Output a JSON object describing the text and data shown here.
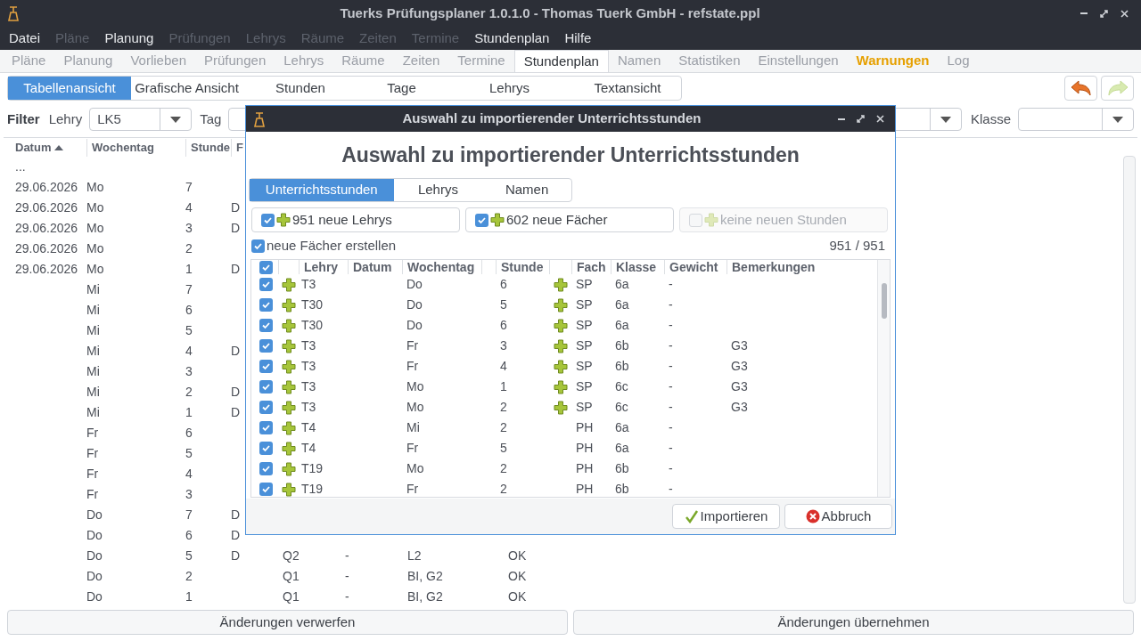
{
  "window": {
    "title": "Tuerks Prüfungsplaner 1.0.1.0 - Thomas Tuerk GmbH - refstate.ppl"
  },
  "menu": [
    {
      "label": "Datei",
      "disabled": false
    },
    {
      "label": "Pläne",
      "disabled": true
    },
    {
      "label": "Planung",
      "disabled": false
    },
    {
      "label": "Prüfungen",
      "disabled": true
    },
    {
      "label": "Lehrys",
      "disabled": true
    },
    {
      "label": "Räume",
      "disabled": true
    },
    {
      "label": "Zeiten",
      "disabled": true
    },
    {
      "label": "Termine",
      "disabled": true
    },
    {
      "label": "Stundenplan",
      "disabled": false
    },
    {
      "label": "Hilfe",
      "disabled": false
    }
  ],
  "tabs": [
    {
      "label": "Pläne",
      "selected": false,
      "kind": "normal"
    },
    {
      "label": "Planung",
      "selected": false,
      "kind": "normal"
    },
    {
      "label": "Vorlieben",
      "selected": false,
      "kind": "normal"
    },
    {
      "label": "Prüfungen",
      "selected": false,
      "kind": "normal"
    },
    {
      "label": "Lehrys",
      "selected": false,
      "kind": "normal"
    },
    {
      "label": "Räume",
      "selected": false,
      "kind": "normal"
    },
    {
      "label": "Zeiten",
      "selected": false,
      "kind": "normal"
    },
    {
      "label": "Termine",
      "selected": false,
      "kind": "normal"
    },
    {
      "label": "Stundenplan",
      "selected": true,
      "kind": "normal"
    },
    {
      "label": "Namen",
      "selected": false,
      "kind": "normal"
    },
    {
      "label": "Statistiken",
      "selected": false,
      "kind": "normal"
    },
    {
      "label": "Einstellungen",
      "selected": false,
      "kind": "normal"
    },
    {
      "label": "Warnungen",
      "selected": false,
      "kind": "warning"
    },
    {
      "label": "Log",
      "selected": false,
      "kind": "normal"
    }
  ],
  "subtabs": [
    {
      "label": "Tabellenansicht",
      "selected": true
    },
    {
      "label": "Grafische Ansicht",
      "selected": false
    },
    {
      "label": "Stunden",
      "selected": false
    },
    {
      "label": "Tage",
      "selected": false
    },
    {
      "label": "Lehrys",
      "selected": false
    },
    {
      "label": "Textansicht",
      "selected": false
    }
  ],
  "toolbar": {
    "undo_disabled": false,
    "redo_disabled": true
  },
  "filter": {
    "title": "Filter",
    "lehry_label": "Lehry",
    "lehry_value": "LK5",
    "tag_label": "Tag",
    "klasse_label": "Klasse"
  },
  "table": {
    "columns": [
      "Datum",
      "Wochentag",
      "Stunde",
      "F"
    ],
    "rows": [
      [
        "...",
        "",
        "",
        "",
        "",
        "",
        "",
        ""
      ],
      [
        "29.06.2026",
        "Mo",
        "7",
        "",
        "",
        "",
        "",
        ""
      ],
      [
        "29.06.2026",
        "Mo",
        "4",
        "D",
        "",
        "",
        "",
        ""
      ],
      [
        "29.06.2026",
        "Mo",
        "3",
        "D",
        "",
        "",
        "",
        ""
      ],
      [
        "29.06.2026",
        "Mo",
        "2",
        "",
        "",
        "",
        "",
        ""
      ],
      [
        "29.06.2026",
        "Mo",
        "1",
        "D",
        "",
        "",
        "",
        ""
      ],
      [
        "",
        "Mi",
        "7",
        "",
        "",
        "",
        "",
        ""
      ],
      [
        "",
        "Mi",
        "6",
        "",
        "",
        "",
        "",
        ""
      ],
      [
        "",
        "Mi",
        "5",
        "",
        "",
        "",
        "",
        ""
      ],
      [
        "",
        "Mi",
        "4",
        "D",
        "",
        "",
        "",
        ""
      ],
      [
        "",
        "Mi",
        "3",
        "",
        "",
        "",
        "",
        ""
      ],
      [
        "",
        "Mi",
        "2",
        "D",
        "",
        "",
        "",
        ""
      ],
      [
        "",
        "Mi",
        "1",
        "D",
        "",
        "",
        "",
        ""
      ],
      [
        "",
        "Fr",
        "6",
        "",
        "",
        "",
        "",
        ""
      ],
      [
        "",
        "Fr",
        "5",
        "",
        "",
        "",
        "",
        ""
      ],
      [
        "",
        "Fr",
        "4",
        "",
        "",
        "",
        "",
        ""
      ],
      [
        "",
        "Fr",
        "3",
        "",
        "",
        "",
        "",
        ""
      ],
      [
        "",
        "Do",
        "7",
        "D",
        "",
        "",
        "",
        ""
      ],
      [
        "",
        "Do",
        "6",
        "D",
        "",
        "",
        "",
        ""
      ],
      [
        "",
        "Do",
        "5",
        "D",
        "Q2",
        "-",
        "L2",
        "OK"
      ],
      [
        "",
        "Do",
        "2",
        "",
        "Q1",
        "-",
        "BI, G2",
        "OK"
      ],
      [
        "",
        "Do",
        "1",
        "",
        "Q1",
        "-",
        "BI, G2",
        "OK"
      ]
    ]
  },
  "bottom_buttons": [
    "Änderungen verwerfen",
    "Änderungen übernehmen"
  ],
  "dialog": {
    "title": "Auswahl zu importierender Unterrichtsstunden",
    "heading": "Auswahl zu importierender Unterrichtsstunden",
    "tabs": [
      {
        "label": "Unterrichtsstunden",
        "selected": true
      },
      {
        "label": "Lehrys",
        "selected": false
      },
      {
        "label": "Namen",
        "selected": false
      }
    ],
    "options": [
      {
        "label": "951 neue Lehrys",
        "checked": true,
        "disabled": false
      },
      {
        "label": "602 neue Fächer",
        "checked": true,
        "disabled": false
      },
      {
        "label": "keine neuen Stunden",
        "checked": false,
        "disabled": true
      }
    ],
    "create_subjects": {
      "label": "neue Fächer erstellen",
      "checked": true
    },
    "count": "951 / 951",
    "columns": [
      "Lehry",
      "Datum",
      "Wochentag",
      "Stunde",
      "Fach",
      "Klasse",
      "Gewicht",
      "Bemerkungen"
    ],
    "all_checked": true,
    "rows": [
      {
        "checked": true,
        "new_lehry": true,
        "lehry": "T3",
        "wochentag": "Do",
        "stunde": "6",
        "new_fach": true,
        "fach": "SP",
        "klasse": "6a",
        "gewicht": "-",
        "bemerkung": ""
      },
      {
        "checked": true,
        "new_lehry": true,
        "lehry": "T30",
        "wochentag": "Do",
        "stunde": "5",
        "new_fach": true,
        "fach": "SP",
        "klasse": "6a",
        "gewicht": "-",
        "bemerkung": ""
      },
      {
        "checked": true,
        "new_lehry": true,
        "lehry": "T30",
        "wochentag": "Do",
        "stunde": "6",
        "new_fach": true,
        "fach": "SP",
        "klasse": "6a",
        "gewicht": "-",
        "bemerkung": ""
      },
      {
        "checked": true,
        "new_lehry": true,
        "lehry": "T3",
        "wochentag": "Fr",
        "stunde": "3",
        "new_fach": true,
        "fach": "SP",
        "klasse": "6b",
        "gewicht": "-",
        "bemerkung": "G3"
      },
      {
        "checked": true,
        "new_lehry": true,
        "lehry": "T3",
        "wochentag": "Fr",
        "stunde": "4",
        "new_fach": true,
        "fach": "SP",
        "klasse": "6b",
        "gewicht": "-",
        "bemerkung": "G3"
      },
      {
        "checked": true,
        "new_lehry": true,
        "lehry": "T3",
        "wochentag": "Mo",
        "stunde": "1",
        "new_fach": true,
        "fach": "SP",
        "klasse": "6c",
        "gewicht": "-",
        "bemerkung": "G3"
      },
      {
        "checked": true,
        "new_lehry": true,
        "lehry": "T3",
        "wochentag": "Mo",
        "stunde": "2",
        "new_fach": true,
        "fach": "SP",
        "klasse": "6c",
        "gewicht": "-",
        "bemerkung": "G3"
      },
      {
        "checked": true,
        "new_lehry": true,
        "lehry": "T4",
        "wochentag": "Mi",
        "stunde": "2",
        "new_fach": false,
        "fach": "PH",
        "klasse": "6a",
        "gewicht": "-",
        "bemerkung": ""
      },
      {
        "checked": true,
        "new_lehry": true,
        "lehry": "T4",
        "wochentag": "Fr",
        "stunde": "5",
        "new_fach": false,
        "fach": "PH",
        "klasse": "6a",
        "gewicht": "-",
        "bemerkung": ""
      },
      {
        "checked": true,
        "new_lehry": true,
        "lehry": "T19",
        "wochentag": "Mo",
        "stunde": "2",
        "new_fach": false,
        "fach": "PH",
        "klasse": "6b",
        "gewicht": "-",
        "bemerkung": ""
      },
      {
        "checked": true,
        "new_lehry": true,
        "lehry": "T19",
        "wochentag": "Fr",
        "stunde": "2",
        "new_fach": false,
        "fach": "PH",
        "klasse": "6b",
        "gewicht": "-",
        "bemerkung": ""
      }
    ],
    "buttons": [
      {
        "label": "Importieren",
        "kind": "ok"
      },
      {
        "label": "Abbruch",
        "kind": "cancel"
      }
    ]
  }
}
